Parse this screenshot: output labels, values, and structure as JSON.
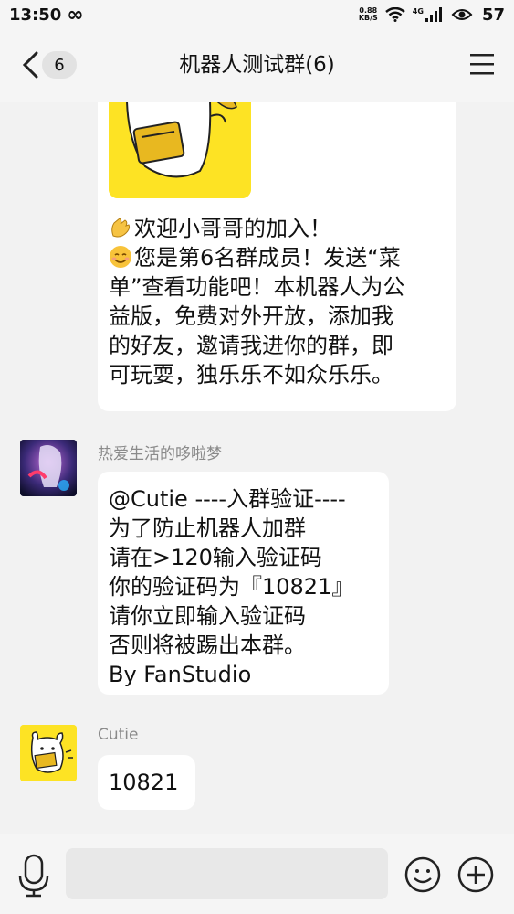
{
  "status_bar": {
    "time": "13:50",
    "infinity_glyph": "∞",
    "net_speed_value": "0.88",
    "net_speed_unit": "KB/S",
    "network_type": "4G",
    "battery": "57"
  },
  "header": {
    "back_count": "6",
    "title": "机器人测试群(6)"
  },
  "messages": [
    {
      "lines": [
        {
          "emoji": "clap-emoji",
          "text": "欢迎小哥哥的加入！"
        },
        {
          "emoji": "smile-emoji",
          "text": "您是第6名群成员！发送“菜"
        },
        {
          "text": "单”查看功能吧！本机器人为公"
        },
        {
          "text": "益版，免费对外开放，添加我"
        },
        {
          "text": "的好友，邀请我进你的群，即"
        },
        {
          "text": "可玩耍，独乐乐不如众乐乐。"
        }
      ]
    },
    {
      "sender": "热爱生活的哆啦梦",
      "lines": [
        "@Cutie ----入群验证----",
        "为了防止机器人加群",
        "请在>120输入验证码",
        "你的验证码为『10821』",
        "请你立即输入验证码",
        "否则将被踢出本群。",
        "By FanStudio"
      ]
    },
    {
      "sender": "Cutie",
      "text": "10821"
    }
  ],
  "input_bar": {
    "placeholder": "",
    "value": ""
  },
  "colors": {
    "background": "#f2f2f2",
    "bubble": "#ffffff",
    "sticker_yellow": "#fde324",
    "name_gray": "#8a8a8a"
  }
}
